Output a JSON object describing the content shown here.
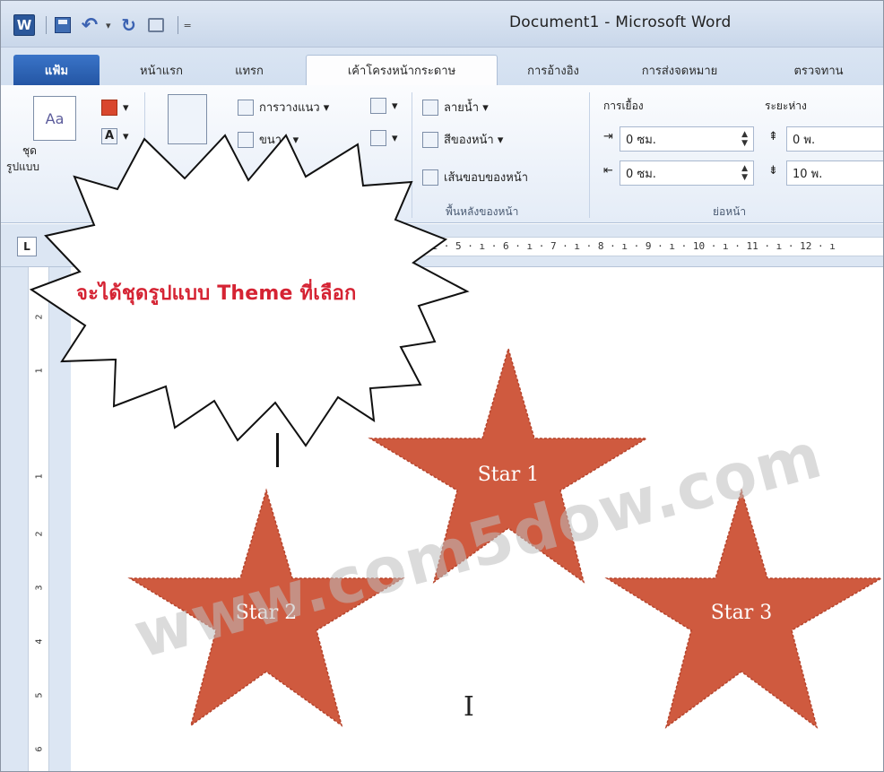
{
  "app": {
    "logo": "W",
    "title": "Document1 - Microsoft Word"
  },
  "quick_access": {
    "icons": [
      "word-logo-icon",
      "save-icon",
      "undo-icon",
      "redo-icon",
      "print-preview-icon"
    ],
    "customize": "="
  },
  "tabs": [
    {
      "label": "แฟ้ม",
      "id": "file"
    },
    {
      "label": "หน้าแรก",
      "id": "home"
    },
    {
      "label": "แทรก",
      "id": "insert"
    },
    {
      "label": "เค้าโครงหน้ากระดาษ",
      "id": "layout"
    },
    {
      "label": "การอ้างอิง",
      "id": "references"
    },
    {
      "label": "การส่งจดหมาย",
      "id": "mailings"
    },
    {
      "label": "ตรวจทาน",
      "id": "review"
    }
  ],
  "ribbon": {
    "themes": {
      "button_label_1": "ชุด",
      "button_label_2": "รูปแบบ",
      "group_label": "ชุดรูป"
    },
    "page_setup": {
      "orientation": "การวางแนว ▾",
      "size": "ขนาด ▾"
    },
    "page_background": {
      "watermark": "ลายน้ำ ▾",
      "page_color": "สีของหน้า ▾",
      "page_borders": "เส้นขอบของหน้า",
      "group_label": "พื้นหลังของหน้า"
    },
    "indent": {
      "label": "การเยื้อง",
      "left": "0 ซม.",
      "right": "0 ซม."
    },
    "spacing": {
      "label": "ระยะห่าง",
      "before": "0 พ.",
      "after": "10 พ."
    },
    "paragraph_group_label": "ย่อหน้า"
  },
  "ruler": {
    "corner": "L",
    "horizontal": "4 · ı · 5 · ı · 6 · ı · 7 · ı · 8 · ı · 9 · ı · 10 · ı · 11 · ı · 12 · ı",
    "vertical": [
      "2",
      "1",
      "1",
      "2",
      "3",
      "4",
      "5",
      "6"
    ]
  },
  "callout": {
    "text": "จะได้ชุดรูปแบบ Theme ที่เลือก",
    "text_color": "#d52333"
  },
  "shapes": [
    {
      "label": "Star 1"
    },
    {
      "label": "Star 2"
    },
    {
      "label": "Star 3"
    }
  ],
  "colors": {
    "star_fill": "#cf5a3f",
    "ribbon_accent": "#2b579a"
  },
  "watermark_text": "www.com5dow.com"
}
